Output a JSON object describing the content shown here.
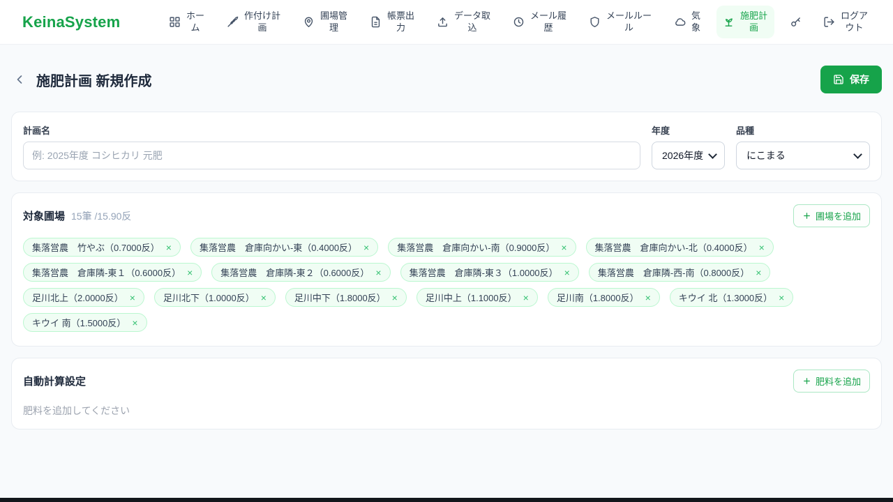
{
  "brand": "KeinaSystem",
  "colors": {
    "brand_green": "#16a34a",
    "active_nav_bg": "#f0fdf4",
    "tag_bg": "#f0fdf4",
    "tag_border": "#bbf7d0"
  },
  "nav": {
    "items": [
      {
        "label": "ホーム",
        "icon": "grid-icon"
      },
      {
        "label": "作付け計画",
        "icon": "wheat-icon"
      },
      {
        "label": "圃場管理",
        "icon": "map-pin-icon"
      },
      {
        "label": "帳票出力",
        "icon": "document-icon"
      },
      {
        "label": "データ取込",
        "icon": "upload-icon"
      },
      {
        "label": "メール履歴",
        "icon": "history-clock-icon"
      },
      {
        "label": "メールルール",
        "icon": "shield-icon"
      },
      {
        "label": "気象",
        "icon": "cloud-icon"
      },
      {
        "label": "施肥計画",
        "icon": "sprout-icon",
        "active": true
      },
      {
        "label": "",
        "icon": "key-icon"
      },
      {
        "label": "ログアウト",
        "icon": "logout-icon"
      }
    ]
  },
  "page": {
    "title": "施肥計画 新規作成",
    "save_label": "保存"
  },
  "form": {
    "plan_name_label": "計画名",
    "plan_name_placeholder": "例: 2025年度 コシヒカリ 元肥",
    "year_label": "年度",
    "year_value": "2026年度",
    "variety_label": "品種",
    "variety_value": "にこまる"
  },
  "fields": {
    "title": "対象圃場",
    "count_text": "15筆 /15.90反",
    "add_button": "圃場を追加",
    "tags": [
      {
        "label": "集落営農　竹やぶ（0.7000反）"
      },
      {
        "label": "集落営農　倉庫向かい-東（0.4000反）"
      },
      {
        "label": "集落営農　倉庫向かい-南（0.9000反）"
      },
      {
        "label": "集落営農　倉庫向かい-北（0.4000反）"
      },
      {
        "label": "集落営農　倉庫隣-東１（0.6000反）"
      },
      {
        "label": "集落営農　倉庫隣-東２（0.6000反）"
      },
      {
        "label": "集落営農　倉庫隣-東３（1.0000反）"
      },
      {
        "label": "集落営農　倉庫隣-西-南（0.8000反）"
      },
      {
        "label": "足川北上（2.0000反）"
      },
      {
        "label": "足川北下（1.0000反）"
      },
      {
        "label": "足川中下（1.8000反）"
      },
      {
        "label": "足川中上（1.1000反）"
      },
      {
        "label": "足川南（1.8000反）"
      },
      {
        "label": "キウイ 北（1.3000反）"
      },
      {
        "label": "キウイ 南（1.5000反）"
      }
    ]
  },
  "auto_calc": {
    "title": "自動計算設定",
    "add_button": "肥料を追加",
    "empty_text": "肥料を追加してください"
  }
}
